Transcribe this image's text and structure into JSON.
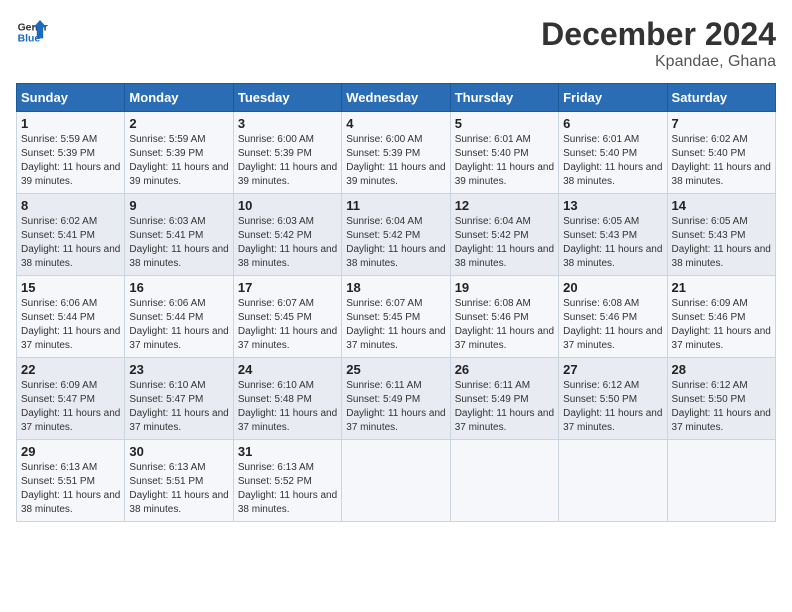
{
  "header": {
    "logo_line1": "General",
    "logo_line2": "Blue",
    "month_title": "December 2024",
    "location": "Kpandae, Ghana"
  },
  "weekdays": [
    "Sunday",
    "Monday",
    "Tuesday",
    "Wednesday",
    "Thursday",
    "Friday",
    "Saturday"
  ],
  "weeks": [
    [
      {
        "day": "1",
        "sunrise": "Sunrise: 5:59 AM",
        "sunset": "Sunset: 5:39 PM",
        "daylight": "Daylight: 11 hours and 39 minutes."
      },
      {
        "day": "2",
        "sunrise": "Sunrise: 5:59 AM",
        "sunset": "Sunset: 5:39 PM",
        "daylight": "Daylight: 11 hours and 39 minutes."
      },
      {
        "day": "3",
        "sunrise": "Sunrise: 6:00 AM",
        "sunset": "Sunset: 5:39 PM",
        "daylight": "Daylight: 11 hours and 39 minutes."
      },
      {
        "day": "4",
        "sunrise": "Sunrise: 6:00 AM",
        "sunset": "Sunset: 5:39 PM",
        "daylight": "Daylight: 11 hours and 39 minutes."
      },
      {
        "day": "5",
        "sunrise": "Sunrise: 6:01 AM",
        "sunset": "Sunset: 5:40 PM",
        "daylight": "Daylight: 11 hours and 39 minutes."
      },
      {
        "day": "6",
        "sunrise": "Sunrise: 6:01 AM",
        "sunset": "Sunset: 5:40 PM",
        "daylight": "Daylight: 11 hours and 38 minutes."
      },
      {
        "day": "7",
        "sunrise": "Sunrise: 6:02 AM",
        "sunset": "Sunset: 5:40 PM",
        "daylight": "Daylight: 11 hours and 38 minutes."
      }
    ],
    [
      {
        "day": "8",
        "sunrise": "Sunrise: 6:02 AM",
        "sunset": "Sunset: 5:41 PM",
        "daylight": "Daylight: 11 hours and 38 minutes."
      },
      {
        "day": "9",
        "sunrise": "Sunrise: 6:03 AM",
        "sunset": "Sunset: 5:41 PM",
        "daylight": "Daylight: 11 hours and 38 minutes."
      },
      {
        "day": "10",
        "sunrise": "Sunrise: 6:03 AM",
        "sunset": "Sunset: 5:42 PM",
        "daylight": "Daylight: 11 hours and 38 minutes."
      },
      {
        "day": "11",
        "sunrise": "Sunrise: 6:04 AM",
        "sunset": "Sunset: 5:42 PM",
        "daylight": "Daylight: 11 hours and 38 minutes."
      },
      {
        "day": "12",
        "sunrise": "Sunrise: 6:04 AM",
        "sunset": "Sunset: 5:42 PM",
        "daylight": "Daylight: 11 hours and 38 minutes."
      },
      {
        "day": "13",
        "sunrise": "Sunrise: 6:05 AM",
        "sunset": "Sunset: 5:43 PM",
        "daylight": "Daylight: 11 hours and 38 minutes."
      },
      {
        "day": "14",
        "sunrise": "Sunrise: 6:05 AM",
        "sunset": "Sunset: 5:43 PM",
        "daylight": "Daylight: 11 hours and 38 minutes."
      }
    ],
    [
      {
        "day": "15",
        "sunrise": "Sunrise: 6:06 AM",
        "sunset": "Sunset: 5:44 PM",
        "daylight": "Daylight: 11 hours and 37 minutes."
      },
      {
        "day": "16",
        "sunrise": "Sunrise: 6:06 AM",
        "sunset": "Sunset: 5:44 PM",
        "daylight": "Daylight: 11 hours and 37 minutes."
      },
      {
        "day": "17",
        "sunrise": "Sunrise: 6:07 AM",
        "sunset": "Sunset: 5:45 PM",
        "daylight": "Daylight: 11 hours and 37 minutes."
      },
      {
        "day": "18",
        "sunrise": "Sunrise: 6:07 AM",
        "sunset": "Sunset: 5:45 PM",
        "daylight": "Daylight: 11 hours and 37 minutes."
      },
      {
        "day": "19",
        "sunrise": "Sunrise: 6:08 AM",
        "sunset": "Sunset: 5:46 PM",
        "daylight": "Daylight: 11 hours and 37 minutes."
      },
      {
        "day": "20",
        "sunrise": "Sunrise: 6:08 AM",
        "sunset": "Sunset: 5:46 PM",
        "daylight": "Daylight: 11 hours and 37 minutes."
      },
      {
        "day": "21",
        "sunrise": "Sunrise: 6:09 AM",
        "sunset": "Sunset: 5:46 PM",
        "daylight": "Daylight: 11 hours and 37 minutes."
      }
    ],
    [
      {
        "day": "22",
        "sunrise": "Sunrise: 6:09 AM",
        "sunset": "Sunset: 5:47 PM",
        "daylight": "Daylight: 11 hours and 37 minutes."
      },
      {
        "day": "23",
        "sunrise": "Sunrise: 6:10 AM",
        "sunset": "Sunset: 5:47 PM",
        "daylight": "Daylight: 11 hours and 37 minutes."
      },
      {
        "day": "24",
        "sunrise": "Sunrise: 6:10 AM",
        "sunset": "Sunset: 5:48 PM",
        "daylight": "Daylight: 11 hours and 37 minutes."
      },
      {
        "day": "25",
        "sunrise": "Sunrise: 6:11 AM",
        "sunset": "Sunset: 5:49 PM",
        "daylight": "Daylight: 11 hours and 37 minutes."
      },
      {
        "day": "26",
        "sunrise": "Sunrise: 6:11 AM",
        "sunset": "Sunset: 5:49 PM",
        "daylight": "Daylight: 11 hours and 37 minutes."
      },
      {
        "day": "27",
        "sunrise": "Sunrise: 6:12 AM",
        "sunset": "Sunset: 5:50 PM",
        "daylight": "Daylight: 11 hours and 37 minutes."
      },
      {
        "day": "28",
        "sunrise": "Sunrise: 6:12 AM",
        "sunset": "Sunset: 5:50 PM",
        "daylight": "Daylight: 11 hours and 37 minutes."
      }
    ],
    [
      {
        "day": "29",
        "sunrise": "Sunrise: 6:13 AM",
        "sunset": "Sunset: 5:51 PM",
        "daylight": "Daylight: 11 hours and 38 minutes."
      },
      {
        "day": "30",
        "sunrise": "Sunrise: 6:13 AM",
        "sunset": "Sunset: 5:51 PM",
        "daylight": "Daylight: 11 hours and 38 minutes."
      },
      {
        "day": "31",
        "sunrise": "Sunrise: 6:13 AM",
        "sunset": "Sunset: 5:52 PM",
        "daylight": "Daylight: 11 hours and 38 minutes."
      },
      null,
      null,
      null,
      null
    ]
  ]
}
